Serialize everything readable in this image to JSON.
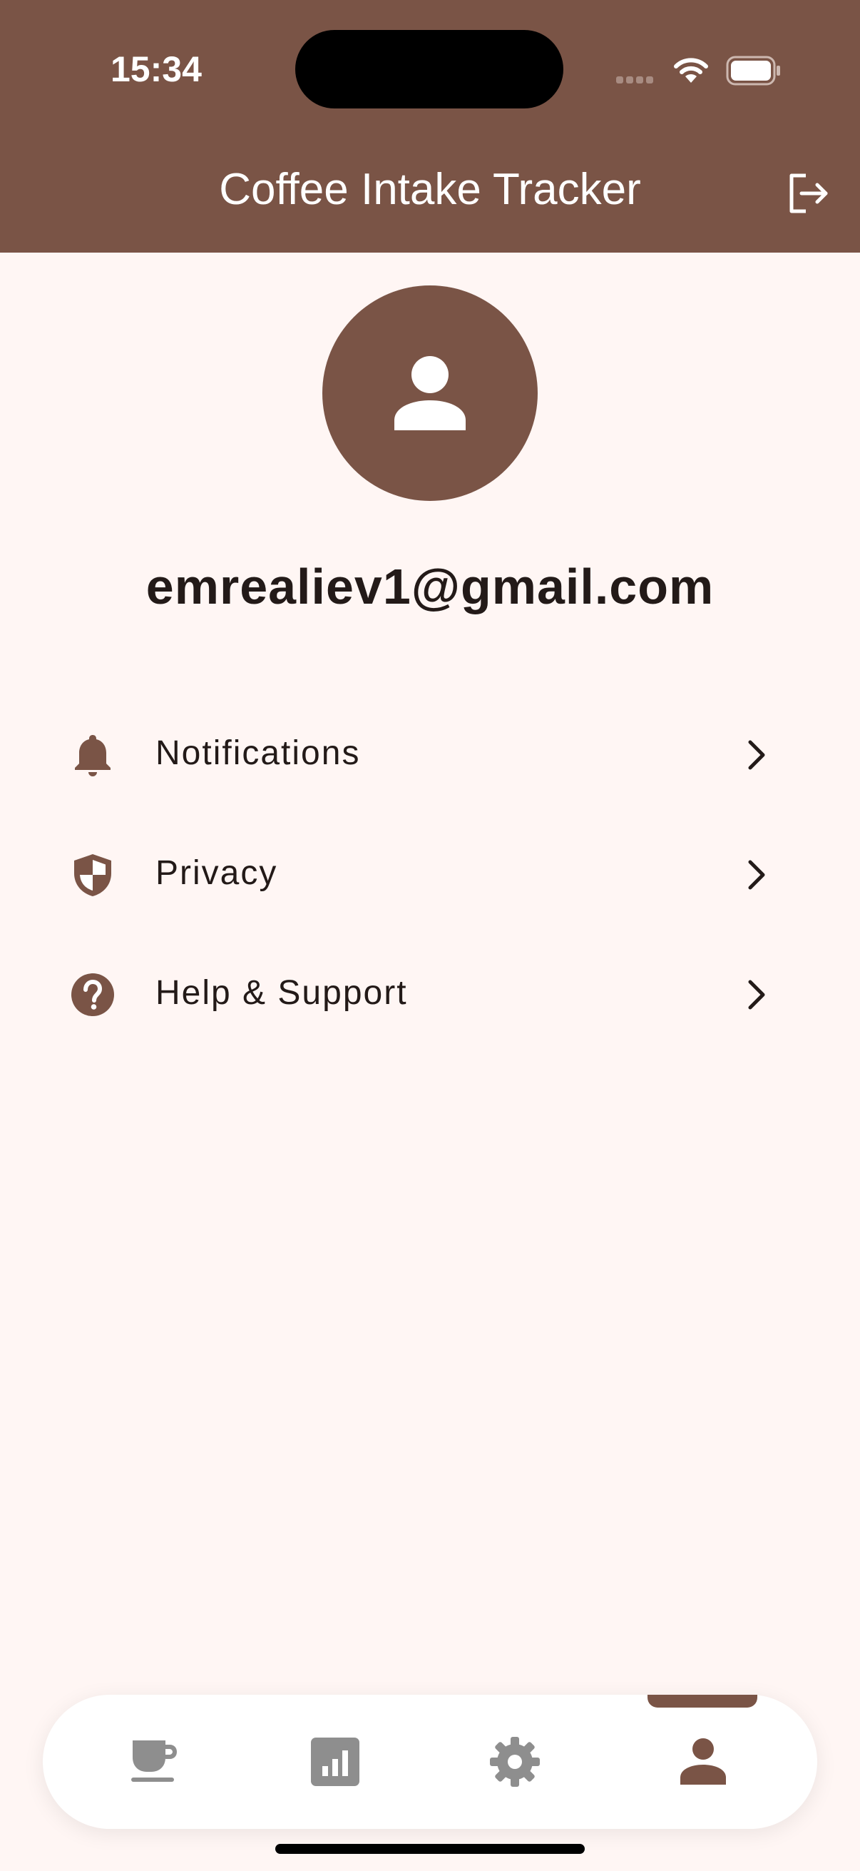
{
  "status_bar": {
    "time": "15:34"
  },
  "app_bar": {
    "title": "Coffee Intake Tracker"
  },
  "profile": {
    "email": "emrealiev1@gmail.com"
  },
  "menu": {
    "items": [
      {
        "label": "Notifications",
        "icon": "bell-icon"
      },
      {
        "label": "Privacy",
        "icon": "shield-icon"
      },
      {
        "label": "Help & Support",
        "icon": "help-circle-icon"
      }
    ]
  },
  "bottom_nav": {
    "items": [
      {
        "icon": "coffee-cup-icon",
        "active": false
      },
      {
        "icon": "bar-chart-icon",
        "active": false
      },
      {
        "icon": "gear-icon",
        "active": false
      },
      {
        "icon": "person-icon",
        "active": true
      }
    ]
  },
  "colors": {
    "primary": "#7A5446",
    "background": "#FFF6F4",
    "inactive_icon": "#8E8E8E",
    "text": "#231A18"
  }
}
